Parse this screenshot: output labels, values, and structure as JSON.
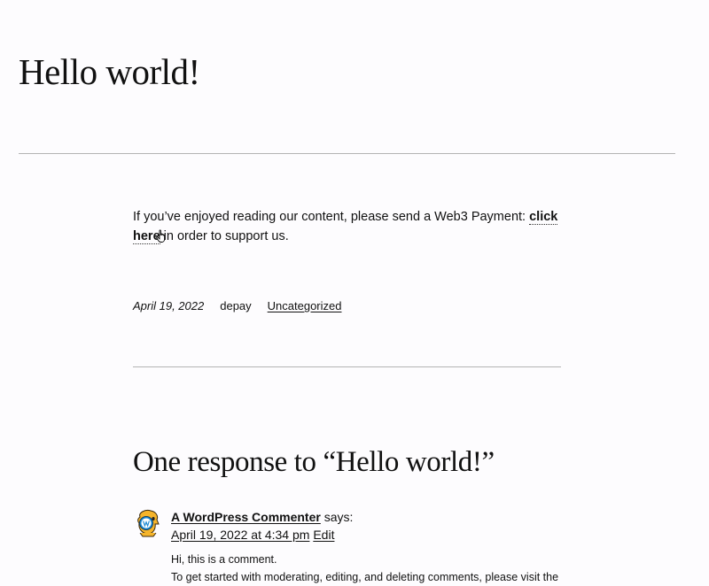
{
  "post": {
    "title": "Hello world!",
    "content_prefix": "If you’ve enjoyed reading our content, please send a Web3 Payment: ",
    "link_label": "click here",
    "content_suffix": " in order to support us.",
    "date": "April 19, 2022",
    "author": "depay",
    "category": "Uncategorized"
  },
  "comments": {
    "title": "One response to “Hello world!”",
    "items": [
      {
        "author": "A WordPress Commenter",
        "says": " says:",
        "date": "April 19, 2022 at 4:34 pm",
        "edit_label": "Edit",
        "text_line1": "Hi, this is a comment.",
        "text_line2": "To get started with moderating, editing, and deleting comments, please visit the"
      }
    ]
  },
  "icons": {
    "cursor": "hand-pointer-icon",
    "avatar": "wordpress-avatar-icon"
  }
}
